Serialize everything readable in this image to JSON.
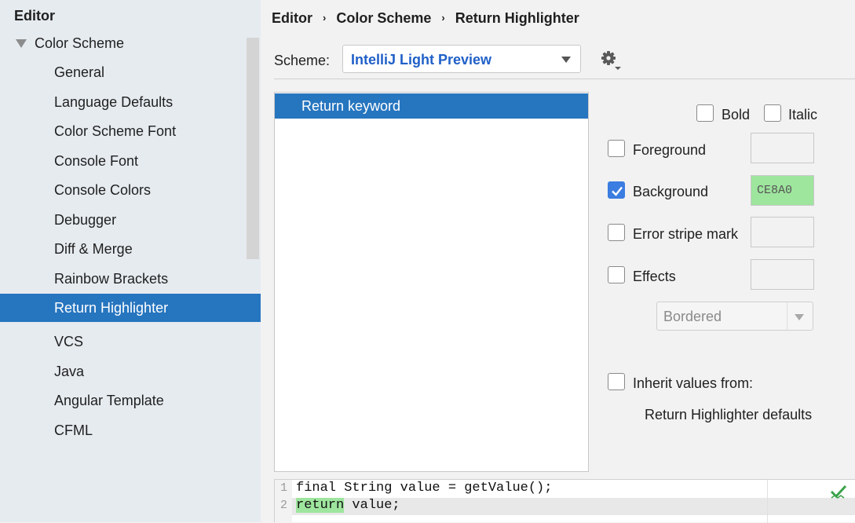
{
  "sidebar": {
    "heading": "Editor",
    "group": "Color Scheme",
    "items": [
      "General",
      "Language Defaults",
      "Color Scheme Font",
      "Console Font",
      "Console Colors",
      "Debugger",
      "Diff & Merge",
      "Rainbow Brackets",
      "Return Highlighter"
    ],
    "more": [
      "VCS",
      "Java",
      "Angular Template",
      "CFML"
    ],
    "selected": "Return Highlighter"
  },
  "breadcrumb": [
    "Editor",
    "Color Scheme",
    "Return Highlighter"
  ],
  "scheme": {
    "label": "Scheme:",
    "value": "IntelliJ Light Preview"
  },
  "attributes": {
    "items": [
      "Return keyword"
    ],
    "selected": "Return keyword"
  },
  "options": {
    "bold": {
      "label": "Bold",
      "checked": false
    },
    "italic": {
      "label": "Italic",
      "checked": false
    },
    "foreground": {
      "label": "Foreground",
      "checked": false,
      "color": ""
    },
    "background": {
      "label": "Background",
      "checked": true,
      "color": "CE8A0",
      "swatch_color": "#9ee59e"
    },
    "error_stripe": {
      "label": "Error stripe mark",
      "checked": false
    },
    "effects": {
      "label": "Effects",
      "checked": false,
      "type": "Bordered"
    },
    "inherit": {
      "label": "Inherit values from:",
      "checked": false,
      "source": "Return Highlighter defaults"
    }
  },
  "preview": {
    "lines": [
      {
        "n": "1",
        "code": "final String value = getValue();"
      },
      {
        "n": "2",
        "keyword": "return",
        "rest": " value;"
      }
    ]
  },
  "colors": {
    "accent": "#2675bf",
    "sidebar_bg": "#e6ebf0",
    "link": "#2060c8"
  }
}
